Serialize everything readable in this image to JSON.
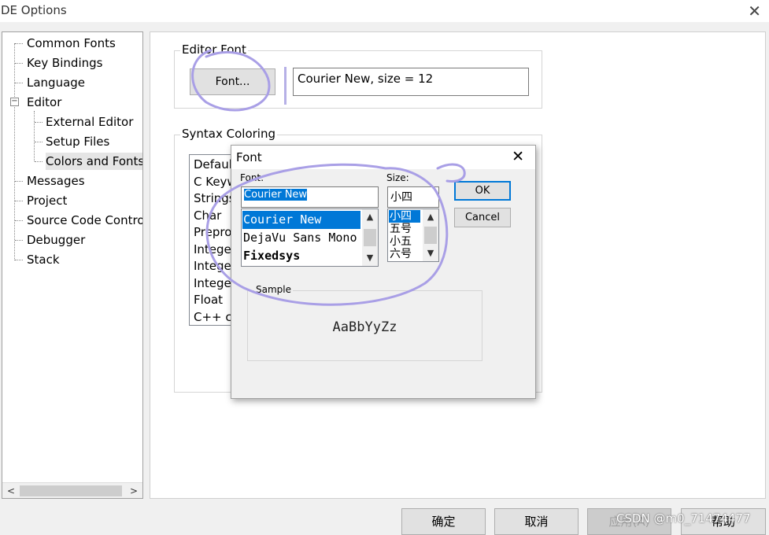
{
  "window": {
    "title": "DE Options",
    "close_glyph": "✕"
  },
  "tree": {
    "items": [
      {
        "label": "Common Fonts"
      },
      {
        "label": "Key Bindings"
      },
      {
        "label": "Language"
      },
      {
        "label": "Editor"
      },
      {
        "label": "External Editor"
      },
      {
        "label": "Setup Files"
      },
      {
        "label": "Colors and Fonts"
      },
      {
        "label": "Messages"
      },
      {
        "label": "Project"
      },
      {
        "label": "Source Code Control"
      },
      {
        "label": "Debugger"
      },
      {
        "label": "Stack"
      }
    ],
    "expander_glyph": "−",
    "scroll_left": "<",
    "scroll_right": ">"
  },
  "editor_font": {
    "group_label": "Editor Font",
    "font_button": "Font...",
    "current_font": "Courier New, size = 12"
  },
  "syntax": {
    "group_label": "Syntax Coloring",
    "items": [
      "Default",
      "C Keywords",
      "Strings",
      "Char",
      "Preprocessor",
      "Integer",
      "Integer",
      "Integer",
      "Float",
      "C++ comments"
    ]
  },
  "font_dialog": {
    "title": "Font",
    "close_glyph": "✕",
    "font_label": "Font:",
    "font_value": "Courier New",
    "fonts": [
      "Courier New",
      "DejaVu Sans Mono",
      "Fixedsys"
    ],
    "size_label": "Size:",
    "size_value": "小四",
    "sizes": [
      "小四",
      "五号",
      "小五",
      "六号"
    ],
    "ok": "OK",
    "cancel": "Cancel",
    "sample_label": "Sample",
    "sample_text": "AaBbYyZz"
  },
  "bottom_buttons": {
    "ok": "确定",
    "cancel": "取消",
    "apply": "应用(A)",
    "help": "帮助"
  },
  "watermark": "CSDN @m0_71474477",
  "colors": {
    "selection": "#0078d7",
    "annotation": "#a99fe6"
  }
}
